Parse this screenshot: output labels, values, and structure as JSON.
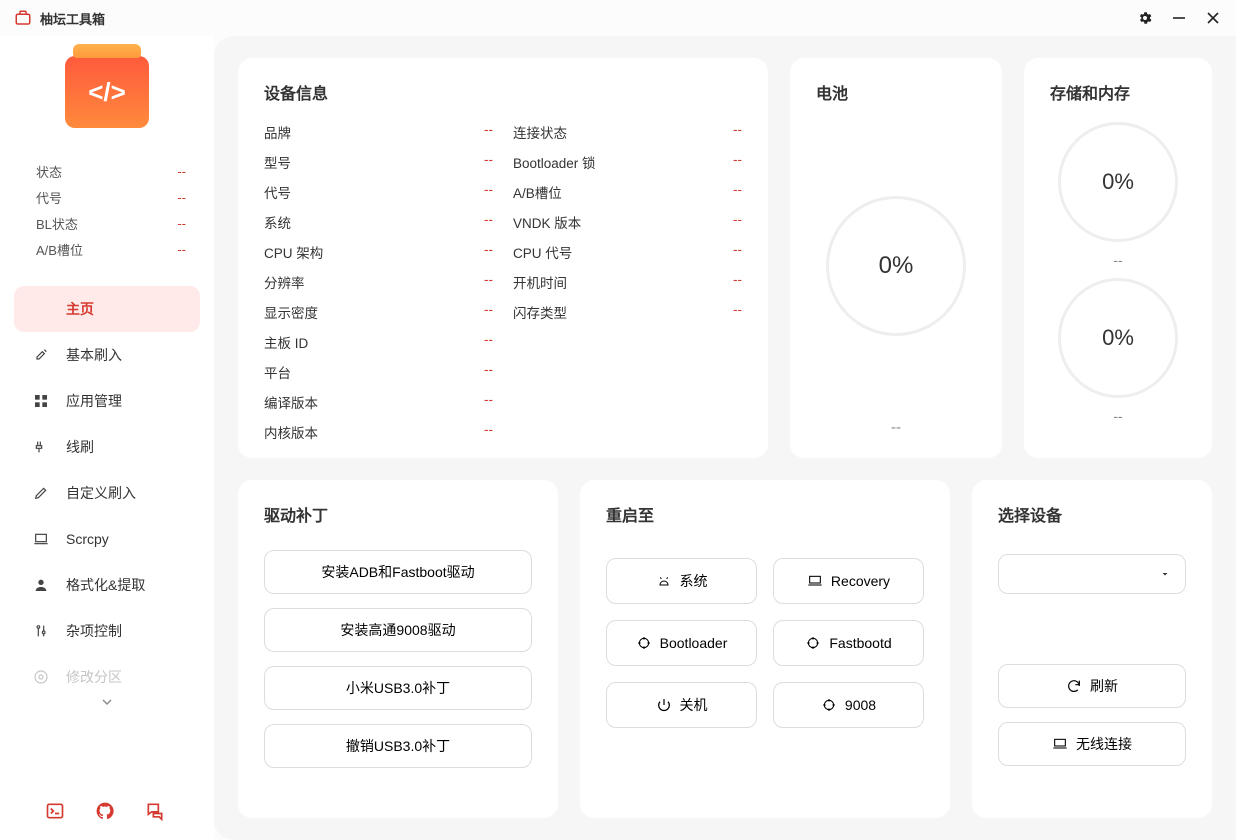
{
  "app": {
    "title": "柚坛工具箱"
  },
  "status": [
    {
      "label": "状态",
      "value": "--"
    },
    {
      "label": "代号",
      "value": "--"
    },
    {
      "label": "BL状态",
      "value": "--"
    },
    {
      "label": "A/B槽位",
      "value": "--"
    }
  ],
  "nav": {
    "home": "主页",
    "items": [
      "基本刷入",
      "应用管理",
      "线刷",
      "自定义刷入",
      "Scrcpy",
      "格式化&提取",
      "杂项控制",
      "修改分区"
    ]
  },
  "device": {
    "title": "设备信息",
    "left": [
      "品牌",
      "型号",
      "代号",
      "系统",
      "CPU 架构",
      "分辨率",
      "显示密度",
      "主板 ID",
      "平台",
      "编译版本",
      "内核版本"
    ],
    "right": [
      "连接状态",
      "Bootloader 锁",
      "A/B槽位",
      "VNDK 版本",
      "CPU 代号",
      "开机时间",
      "闪存类型"
    ],
    "dash": "--"
  },
  "battery": {
    "title": "电池",
    "percent": "0%",
    "footer": "--"
  },
  "storage": {
    "title": "存储和内存",
    "p1": "0%",
    "s1": "--",
    "p2": "0%",
    "s2": "--"
  },
  "driver": {
    "title": "驱动补丁",
    "btns": [
      "安装ADB和Fastboot驱动",
      "安装高通9008驱动",
      "小米USB3.0补丁",
      "撤销USB3.0补丁"
    ]
  },
  "reboot": {
    "title": "重启至",
    "btns": [
      "系统",
      "Recovery",
      "Bootloader",
      "Fastbootd",
      "关机",
      "9008"
    ]
  },
  "selectdev": {
    "title": "选择设备",
    "refresh": "刷新",
    "wireless": "无线连接"
  }
}
